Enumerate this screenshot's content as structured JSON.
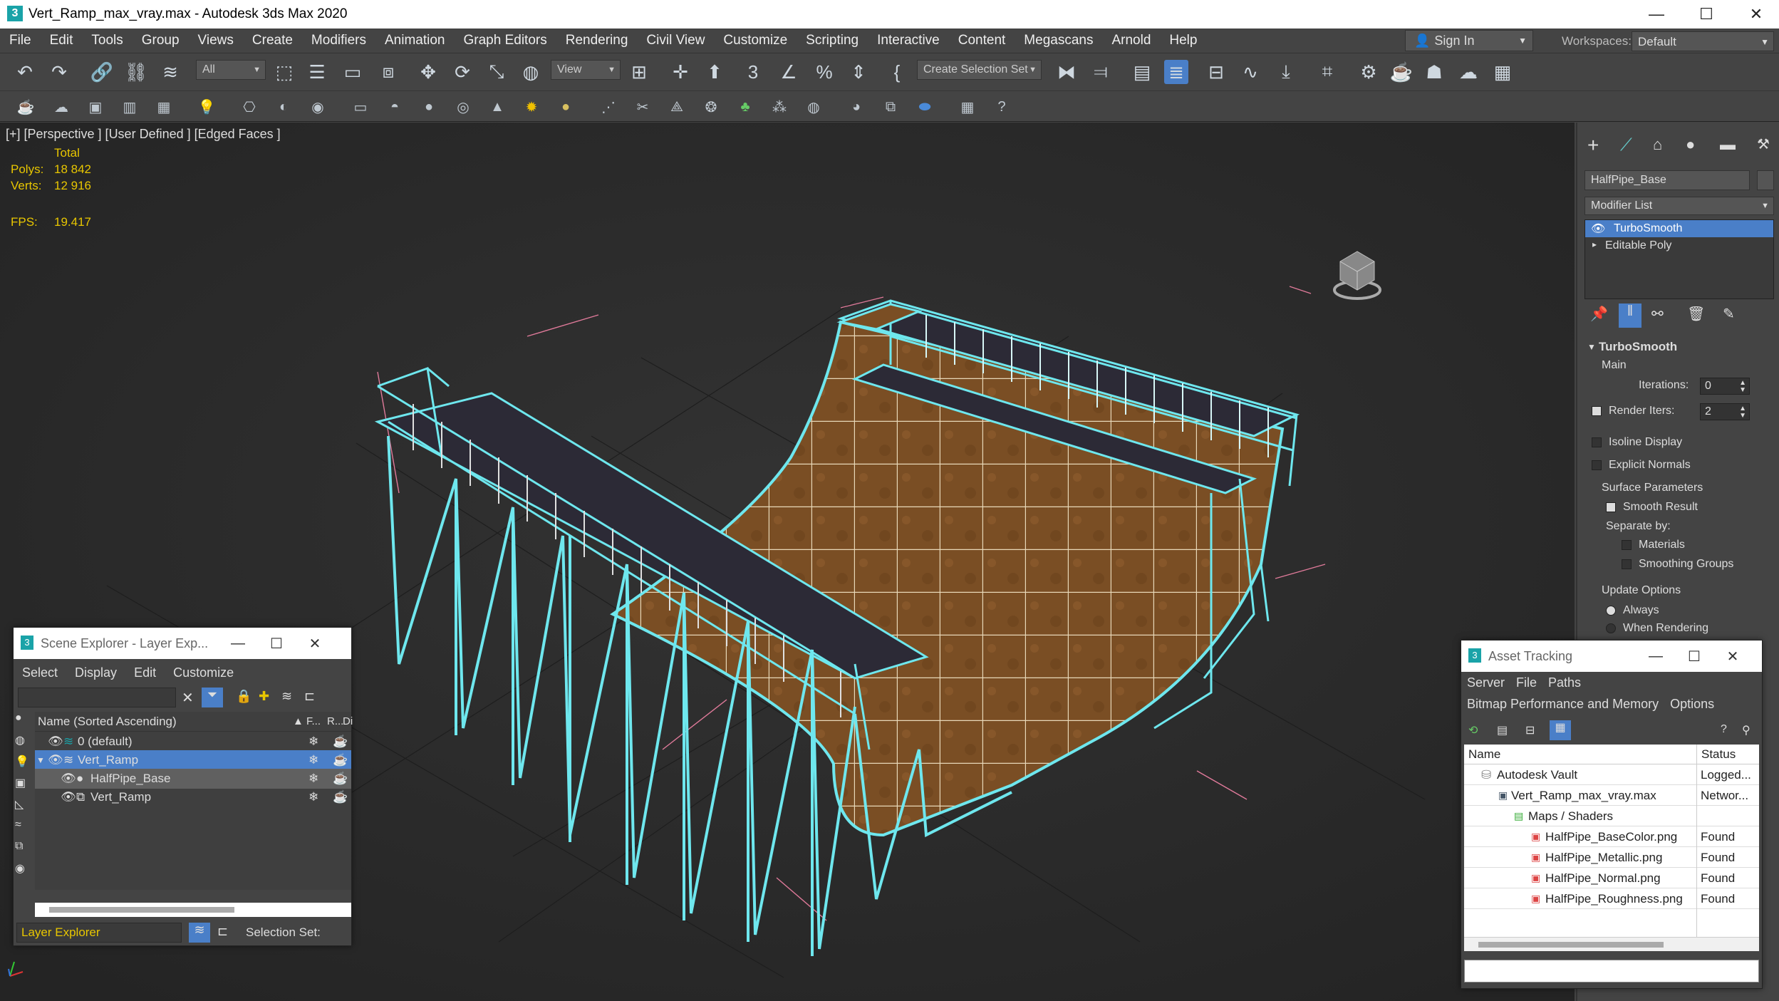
{
  "window": {
    "title": "Vert_Ramp_max_vray.max - Autodesk 3ds Max 2020",
    "min": "—",
    "max": "☐",
    "close": "✕"
  },
  "menu": [
    "File",
    "Edit",
    "Tools",
    "Group",
    "Views",
    "Create",
    "Modifiers",
    "Animation",
    "Graph Editors",
    "Rendering",
    "Civil View",
    "Customize",
    "Scripting",
    "Interactive",
    "Content",
    "Megascans",
    "Arnold",
    "Help"
  ],
  "signin": {
    "label": "Sign In"
  },
  "workspaces": {
    "label": "Workspaces:",
    "value": "Default"
  },
  "toolbar": {
    "selection_filter": "All",
    "ref_coord": "View",
    "create_selection_set": "Create Selection Set"
  },
  "viewport": {
    "label": "[+] [Perspective ] [User Defined ] [Edged Faces ]",
    "stats_header": "Total",
    "polys_label": "Polys:",
    "polys_value": "18 842",
    "verts_label": "Verts:",
    "verts_value": "12 916",
    "fps_label": "FPS:",
    "fps_value": "19.417"
  },
  "command_panel": {
    "object_name": "HalfPipe_Base",
    "modifier_list": "Modifier List",
    "stack": [
      "TurboSmooth",
      "Editable Poly"
    ],
    "rollout_title": "TurboSmooth",
    "main": "Main",
    "iterations_label": "Iterations:",
    "iterations_value": "0",
    "render_iters_label": "Render Iters:",
    "render_iters_value": "2",
    "isoline": "Isoline Display",
    "explicit_normals": "Explicit Normals",
    "surface_params": "Surface Parameters",
    "smooth_result": "Smooth Result",
    "separate_by": "Separate by:",
    "materials": "Materials",
    "smoothing_groups": "Smoothing Groups",
    "update_options": "Update Options",
    "always": "Always",
    "when_rendering": "When Rendering"
  },
  "scene_explorer": {
    "title": "Scene Explorer - Layer Exp...",
    "menu": [
      "Select",
      "Display",
      "Edit",
      "Customize"
    ],
    "col_name": "Name (Sorted Ascending)",
    "col_f": "▲ F...",
    "col_r": "R...",
    "col_d": "Di",
    "rows": [
      "0 (default)",
      "Vert_Ramp",
      "HalfPipe_Base",
      "Vert_Ramp"
    ],
    "footer_mode": "Layer Explorer",
    "selection_set": "Selection Set:"
  },
  "asset_tracking": {
    "title": "Asset Tracking",
    "menu1": [
      "Server",
      "File",
      "Paths"
    ],
    "menu2": [
      "Bitmap Performance and Memory",
      "Options"
    ],
    "col_name": "Name",
    "col_status": "Status",
    "rows": [
      {
        "name": "Autodesk Vault",
        "status": "Logged..."
      },
      {
        "name": "Vert_Ramp_max_vray.max",
        "status": "Networ..."
      },
      {
        "name": "Maps / Shaders",
        "status": ""
      },
      {
        "name": "HalfPipe_BaseColor.png",
        "status": "Found"
      },
      {
        "name": "HalfPipe_Metallic.png",
        "status": "Found"
      },
      {
        "name": "HalfPipe_Normal.png",
        "status": "Found"
      },
      {
        "name": "HalfPipe_Roughness.png",
        "status": "Found"
      }
    ]
  },
  "colors": {
    "selection_wire": "#6ee7ee",
    "viewport_bg": "#2b2b2b",
    "stat_yellow": "#e8c600",
    "ramp_wood": "#8a5a2b",
    "highlight_blue": "#4a7fc8"
  }
}
